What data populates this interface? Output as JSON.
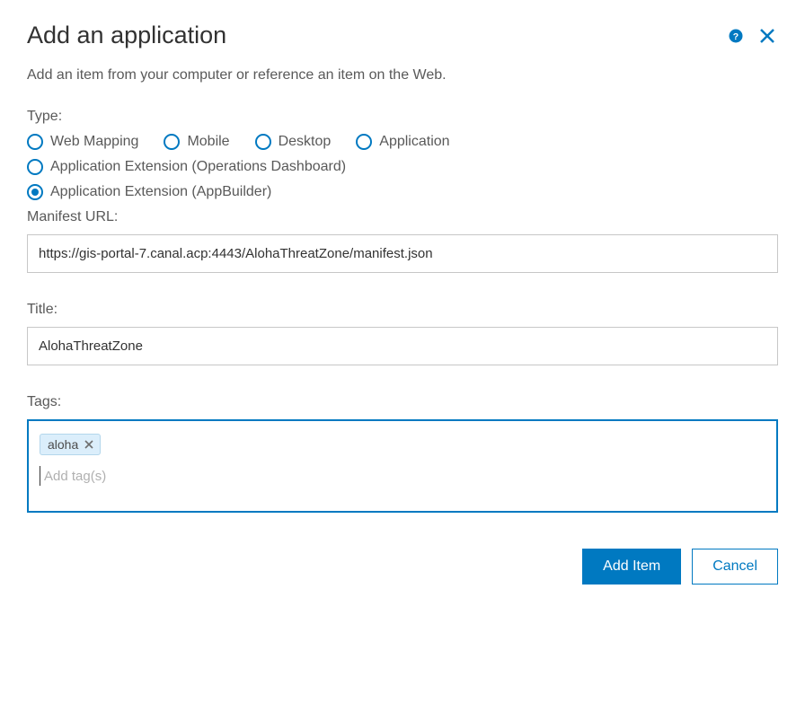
{
  "header": {
    "title": "Add an application",
    "subtitle": "Add an item from your computer or reference an item on the Web."
  },
  "type": {
    "label": "Type:",
    "options": [
      {
        "key": "web_mapping",
        "label": "Web Mapping",
        "selected": false
      },
      {
        "key": "mobile",
        "label": "Mobile",
        "selected": false
      },
      {
        "key": "desktop",
        "label": "Desktop",
        "selected": false
      },
      {
        "key": "application",
        "label": "Application",
        "selected": false
      },
      {
        "key": "ext_ops",
        "label": "Application Extension (Operations Dashboard)",
        "selected": false
      },
      {
        "key": "ext_appbuilder",
        "label": "Application Extension (AppBuilder)",
        "selected": true
      }
    ]
  },
  "manifest": {
    "label": "Manifest URL:",
    "value": "https://gis-portal-7.canal.acp:4443/AlohaThreatZone/manifest.json"
  },
  "title_field": {
    "label": "Title:",
    "value": "AlohaThreatZone"
  },
  "tags": {
    "label": "Tags:",
    "items": [
      {
        "text": "aloha"
      }
    ],
    "placeholder": "Add tag(s)"
  },
  "footer": {
    "primary": "Add Item",
    "secondary": "Cancel"
  },
  "colors": {
    "accent": "#0079c1"
  }
}
